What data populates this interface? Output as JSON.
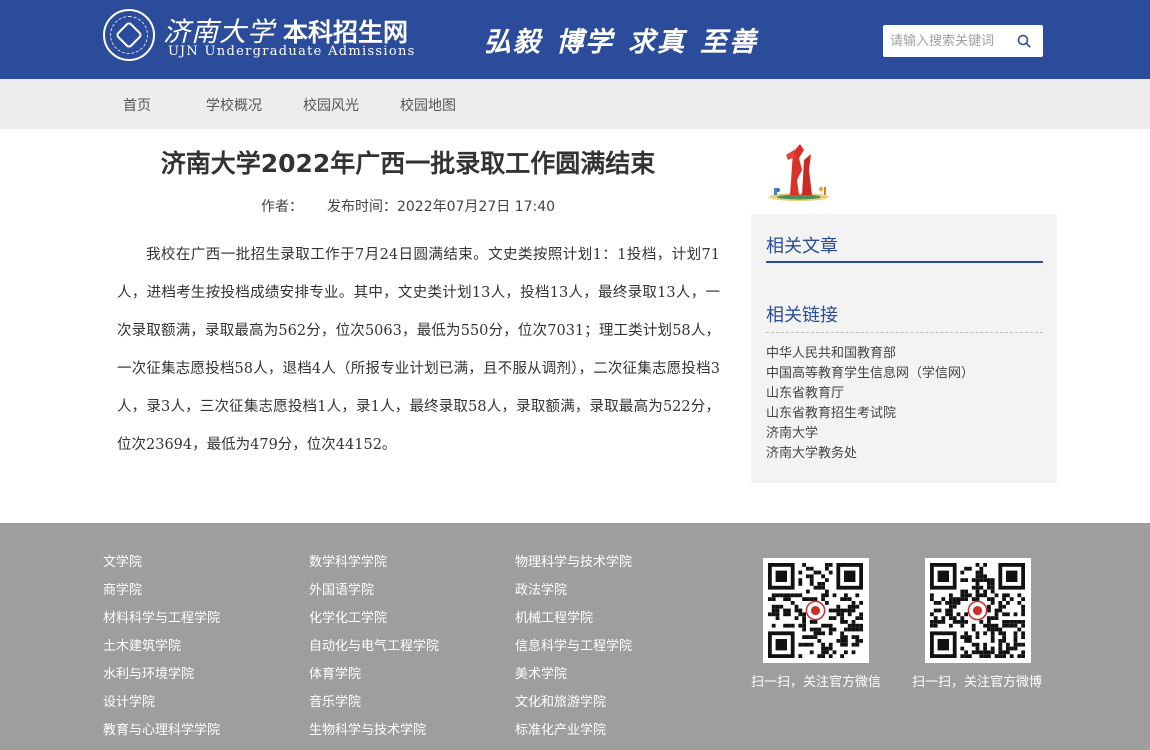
{
  "header": {
    "logo_cn": "济南大学",
    "site_name": "本科招生网",
    "logo_en": "UJN Undergraduate Admissions",
    "motto": [
      "弘毅",
      "博学",
      "求真",
      "至善"
    ],
    "search_placeholder": "请输入搜索关键词"
  },
  "nav": {
    "items": [
      {
        "label": "首页"
      },
      {
        "label": "学校概况"
      },
      {
        "label": "校园风光"
      },
      {
        "label": "校园地图"
      }
    ]
  },
  "article": {
    "title": "济南大学2022年广西一批录取工作圆满结束",
    "author_label": "作者：",
    "publish_label": "发布时间：2022年07月27日 17:40",
    "body": "我校在广西一批招生录取工作于7月24日圆满结束。文史类按照计划1：1投档，计划71人，进档考生按投档成绩安排专业。其中，文史类计划13人，投档13人，最终录取13人，一次录取额满，录取最高为562分，位次5063，最低为550分，位次7031；理工类计划58人，一次征集志愿投档58人，退档4人（所报专业计划已满，且不服从调剂），二次征集志愿投档3人，录3人，三次征集志愿投档1人，录1人，最终录取58人，录取额满，录取最高为522分，位次23694，最低为479分，位次44152。"
  },
  "sidebar": {
    "related_articles_title": "相关文章",
    "related_links_title": "相关链接",
    "links": [
      {
        "label": "中华人民共和国教育部"
      },
      {
        "label": "中国高等教育学生信息网（学信网）"
      },
      {
        "label": "山东省教育厅"
      },
      {
        "label": "山东省教育招生考试院"
      },
      {
        "label": "济南大学"
      },
      {
        "label": "济南大学教务处"
      }
    ]
  },
  "footer": {
    "col1": [
      "文学院",
      "商学院",
      "材料科学与工程学院",
      "土木建筑学院",
      "水利与环境学院",
      "设计学院",
      "教育与心理科学学院"
    ],
    "col2": [
      "数学科学学院",
      "外国语学院",
      "化学化工学院",
      "自动化与电气工程学院",
      "体育学院",
      "音乐学院",
      "生物科学与技术学院"
    ],
    "col3": [
      "物理科学与技术学院",
      "政法学院",
      "机械工程学院",
      "信息科学与工程学院",
      "美术学院",
      "文化和旅游学院",
      "标准化产业学院"
    ],
    "qr1_caption": "扫一扫，关注官方微信",
    "qr2_caption": "扫一扫，关注官方微博"
  },
  "colors": {
    "header_bg": "#2b4c9a",
    "nav_bg": "#ededed",
    "footer_bg": "#9e9e9e",
    "accent": "#2b4c9a"
  }
}
